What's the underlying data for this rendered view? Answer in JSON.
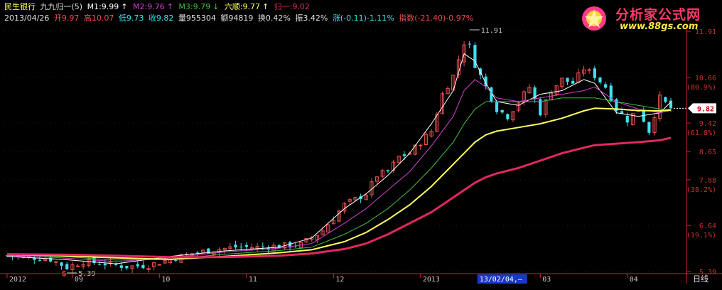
{
  "header": {
    "stock_name": "民生银行",
    "indicator": "九九归一(5)",
    "m1": "M1:9.99",
    "m2": "M2:9.76",
    "m3": "M3:9.79",
    "liushun": "六顺:9.77",
    "guiyi": "归一:9.02",
    "date": "2013/04/26",
    "open": "开9.97",
    "high": "高10.07",
    "low": "低9.73",
    "close": "收9.82",
    "volume": "量955304",
    "amount": "额94819",
    "turnover": "换0.42%",
    "amplitude": "振3.42%",
    "change": "涨(-0.11)-1.11%",
    "index": "指数(-21.40)-0.97%"
  },
  "logo": {
    "title": "分析家公式网",
    "url": "www.88gs.com"
  },
  "colors": {
    "up": "#e85050",
    "down": "#40e0f0",
    "m1": "#ffffff",
    "m2": "#d040d0",
    "m3": "#40c040",
    "liushun": "#ffff60",
    "guiyi": "#e02860",
    "axis": "#c82828",
    "price_tag_bg": "#ffffff"
  },
  "chart_data": {
    "type": "candlestick",
    "timeframe": "日线",
    "x_tick_labels": [
      "2012",
      "09",
      "10",
      "11",
      "12",
      "2013",
      "03",
      "04"
    ],
    "cursor_date": "13/02/04,—",
    "y_ticks": [
      {
        "value": 11.91,
        "label": "11.91",
        "pct": ""
      },
      {
        "value": 10.66,
        "label": "10.66",
        "pct": "(80.9%)"
      },
      {
        "value": 9.42,
        "label": "9.42",
        "pct": "(61.8%)"
      },
      {
        "value": 8.65,
        "label": "8.65",
        "pct": ""
      },
      {
        "value": 7.88,
        "label": "7.88",
        "pct": "(38.2%)"
      },
      {
        "value": 6.64,
        "label": "6.64",
        "pct": "(19.1%)"
      },
      {
        "value": 5.39,
        "label": "5.39",
        "pct": ""
      }
    ],
    "ylim": [
      5.39,
      11.91
    ],
    "current_price": "9.82",
    "annotations": [
      {
        "label": "11.91",
        "x_index": 85,
        "value": 11.91,
        "kind": "high"
      },
      {
        "label": "5.39",
        "x_index": 11,
        "value": 5.39,
        "kind": "low"
      }
    ],
    "close_path": [
      [
        0,
        5.82
      ],
      [
        4,
        5.78
      ],
      [
        8,
        5.72
      ],
      [
        11,
        5.5
      ],
      [
        14,
        5.66
      ],
      [
        18,
        5.6
      ],
      [
        22,
        5.52
      ],
      [
        26,
        5.56
      ],
      [
        30,
        5.72
      ],
      [
        34,
        5.88
      ],
      [
        38,
        5.98
      ],
      [
        42,
        6.05
      ],
      [
        46,
        6.05
      ],
      [
        50,
        6.08
      ],
      [
        54,
        6.12
      ],
      [
        58,
        6.5
      ],
      [
        62,
        7.2
      ],
      [
        66,
        7.5
      ],
      [
        68,
        8.0
      ],
      [
        70,
        8.1
      ],
      [
        72,
        8.5
      ],
      [
        74,
        8.6
      ],
      [
        76,
        8.9
      ],
      [
        78,
        9.2
      ],
      [
        80,
        10.2
      ],
      [
        82,
        10.7
      ],
      [
        84,
        11.6
      ],
      [
        85,
        11.5
      ],
      [
        86,
        11.0
      ],
      [
        88,
        10.4
      ],
      [
        90,
        9.8
      ],
      [
        92,
        9.6
      ],
      [
        94,
        10.0
      ],
      [
        96,
        10.4
      ],
      [
        98,
        9.7
      ],
      [
        100,
        10.3
      ],
      [
        102,
        10.6
      ],
      [
        104,
        10.5
      ],
      [
        106,
        10.9
      ],
      [
        108,
        10.7
      ],
      [
        110,
        10.4
      ],
      [
        112,
        9.8
      ],
      [
        114,
        9.5
      ],
      [
        116,
        9.8
      ],
      [
        118,
        9.2
      ],
      [
        120,
        10.1
      ],
      [
        122,
        9.82
      ]
    ],
    "series": [
      {
        "name": "M1",
        "values": [
          [
            0,
            5.8
          ],
          [
            10,
            5.72
          ],
          [
            20,
            5.6
          ],
          [
            30,
            5.8
          ],
          [
            40,
            5.95
          ],
          [
            50,
            6.05
          ],
          [
            56,
            6.3
          ],
          [
            62,
            7.1
          ],
          [
            66,
            7.5
          ],
          [
            70,
            8.0
          ],
          [
            74,
            8.6
          ],
          [
            78,
            9.4
          ],
          [
            82,
            10.3
          ],
          [
            84,
            11.3
          ],
          [
            86,
            11.1
          ],
          [
            88,
            10.5
          ],
          [
            90,
            10.0
          ],
          [
            94,
            9.9
          ],
          [
            98,
            10.2
          ],
          [
            102,
            10.3
          ],
          [
            106,
            10.6
          ],
          [
            108,
            10.5
          ],
          [
            112,
            9.7
          ],
          [
            116,
            9.6
          ],
          [
            120,
            9.7
          ],
          [
            122,
            9.99
          ]
        ]
      },
      {
        "name": "M2",
        "values": [
          [
            0,
            5.82
          ],
          [
            10,
            5.76
          ],
          [
            20,
            5.66
          ],
          [
            30,
            5.76
          ],
          [
            40,
            5.92
          ],
          [
            50,
            6.02
          ],
          [
            56,
            6.15
          ],
          [
            62,
            6.7
          ],
          [
            66,
            7.1
          ],
          [
            70,
            7.6
          ],
          [
            74,
            8.1
          ],
          [
            78,
            8.8
          ],
          [
            82,
            9.6
          ],
          [
            84,
            10.3
          ],
          [
            86,
            10.6
          ],
          [
            88,
            10.4
          ],
          [
            90,
            10.1
          ],
          [
            94,
            10.0
          ],
          [
            98,
            10.1
          ],
          [
            102,
            10.2
          ],
          [
            106,
            10.3
          ],
          [
            108,
            10.4
          ],
          [
            112,
            10.0
          ],
          [
            116,
            9.8
          ],
          [
            120,
            9.7
          ],
          [
            122,
            9.76
          ]
        ]
      },
      {
        "name": "M3",
        "values": [
          [
            0,
            5.84
          ],
          [
            10,
            5.8
          ],
          [
            20,
            5.7
          ],
          [
            30,
            5.72
          ],
          [
            40,
            5.86
          ],
          [
            50,
            5.96
          ],
          [
            56,
            6.05
          ],
          [
            62,
            6.4
          ],
          [
            66,
            6.7
          ],
          [
            70,
            7.1
          ],
          [
            74,
            7.6
          ],
          [
            78,
            8.2
          ],
          [
            82,
            8.9
          ],
          [
            84,
            9.4
          ],
          [
            86,
            9.8
          ],
          [
            88,
            10.0
          ],
          [
            90,
            10.0
          ],
          [
            94,
            10.0
          ],
          [
            98,
            10.0
          ],
          [
            102,
            10.1
          ],
          [
            106,
            10.1
          ],
          [
            108,
            10.1
          ],
          [
            112,
            10.0
          ],
          [
            116,
            9.9
          ],
          [
            120,
            9.8
          ],
          [
            122,
            9.79
          ]
        ]
      },
      {
        "name": "六顺",
        "values": [
          [
            0,
            5.85
          ],
          [
            10,
            5.82
          ],
          [
            20,
            5.76
          ],
          [
            30,
            5.72
          ],
          [
            40,
            5.8
          ],
          [
            50,
            5.9
          ],
          [
            56,
            5.98
          ],
          [
            62,
            6.2
          ],
          [
            66,
            6.45
          ],
          [
            70,
            6.8
          ],
          [
            74,
            7.2
          ],
          [
            78,
            7.7
          ],
          [
            82,
            8.3
          ],
          [
            84,
            8.6
          ],
          [
            86,
            8.9
          ],
          [
            88,
            9.1
          ],
          [
            90,
            9.2
          ],
          [
            94,
            9.3
          ],
          [
            98,
            9.4
          ],
          [
            102,
            9.55
          ],
          [
            106,
            9.75
          ],
          [
            108,
            9.82
          ],
          [
            112,
            9.8
          ],
          [
            116,
            9.76
          ],
          [
            120,
            9.75
          ],
          [
            122,
            9.77
          ]
        ]
      },
      {
        "name": "归一",
        "values": [
          [
            0,
            5.86
          ],
          [
            10,
            5.85
          ],
          [
            20,
            5.82
          ],
          [
            30,
            5.78
          ],
          [
            40,
            5.78
          ],
          [
            50,
            5.82
          ],
          [
            56,
            5.88
          ],
          [
            62,
            6.0
          ],
          [
            66,
            6.15
          ],
          [
            70,
            6.4
          ],
          [
            74,
            6.7
          ],
          [
            78,
            7.0
          ],
          [
            82,
            7.4
          ],
          [
            84,
            7.6
          ],
          [
            86,
            7.8
          ],
          [
            88,
            7.95
          ],
          [
            90,
            8.05
          ],
          [
            94,
            8.2
          ],
          [
            98,
            8.4
          ],
          [
            102,
            8.6
          ],
          [
            106,
            8.75
          ],
          [
            108,
            8.82
          ],
          [
            112,
            8.86
          ],
          [
            116,
            8.9
          ],
          [
            120,
            8.95
          ],
          [
            122,
            9.02
          ]
        ]
      }
    ]
  }
}
